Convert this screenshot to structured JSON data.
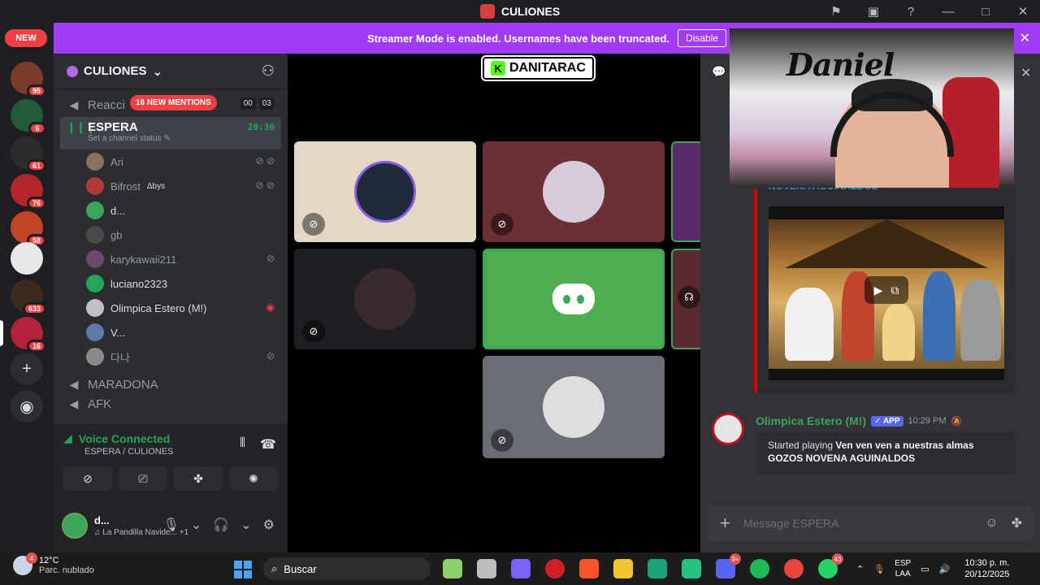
{
  "window": {
    "title": "CULIONES",
    "icons": [
      "flag-icon",
      "inbox-icon",
      "help-icon",
      "minimize-icon",
      "maximize-icon",
      "close-icon"
    ]
  },
  "rail": {
    "new_label": "NEW",
    "servers": [
      {
        "badge": "95",
        "color": "#7a3b2c"
      },
      {
        "badge": "6",
        "color": "#1f5a3a"
      },
      {
        "badge": "61",
        "color": "#2b2b2b"
      },
      {
        "badge": "76",
        "color": "#b5262c"
      },
      {
        "badge": "58",
        "color": "#c2452a"
      },
      {
        "badge": "",
        "color": "#e8e8e8"
      },
      {
        "badge": "633",
        "color": "#3b2a1e"
      },
      {
        "badge": "16",
        "color": "#b3223a"
      }
    ]
  },
  "banner": {
    "text": "Streamer Mode is enabled. Usernames have been truncated.",
    "button": "Disable"
  },
  "guild": {
    "name": "CULIONES"
  },
  "channels": {
    "reacc": {
      "name": "Reacci",
      "mentions": "16 NEW MENTIONS",
      "count_a": "00",
      "count_b": "03"
    },
    "active": {
      "name": "ESPERA",
      "timer": "20:36",
      "status": "Set a channel status"
    },
    "users": [
      {
        "name": "Ari",
        "color": "#8a7060"
      },
      {
        "name": "Bifrost",
        "tag": "Δbys",
        "color": "#b03a3a"
      },
      {
        "name": "d...",
        "color": "#3ba55c",
        "bright": true
      },
      {
        "name": "gb",
        "color": "#4a4a4a"
      },
      {
        "name": "karykawaii211",
        "color": "#6a4a6a"
      },
      {
        "name": "luciano2323",
        "color": "#23a55a",
        "bright": true
      },
      {
        "name": "Olimpica Estero (M!)",
        "color": "#c0c0c0",
        "bright": true
      },
      {
        "name": "V...",
        "color": "#5a7aa8",
        "bright": true
      },
      {
        "name": "다나",
        "color": "#8a8a8a"
      }
    ],
    "maradona": "MARADONA",
    "afk": "AFK"
  },
  "voice": {
    "title": "Voice Connected",
    "subtitle": "ESPERA / CULIONES"
  },
  "user": {
    "name": "d...",
    "activity": "La Pandilla Navide...",
    "extra": "+1"
  },
  "stage": {
    "streamer_label": "DANITARAC"
  },
  "chat": {
    "embed_title": "NOVENA AGUINALDOS",
    "message": {
      "author": "Olimpica Estero (M!)",
      "tag": "APP",
      "time": "10:29 PM",
      "prefix": "Started playing",
      "song": "Ven ven ven a nuestras almas GOZOS NOVENA AGUINALDOS"
    },
    "composer_placeholder": "Message ESPERA"
  },
  "taskbar": {
    "temp": "12°C",
    "condition": "Parc. nublado",
    "weather_badge": "4",
    "search": "Buscar",
    "apps": [
      {
        "name": "widgets-app",
        "color": "#8bd16a",
        "badge": ""
      },
      {
        "name": "task-view-app",
        "color": "#bdbdbd",
        "badge": ""
      },
      {
        "name": "copilot-app",
        "color": "#7b61ff",
        "badge": ""
      },
      {
        "name": "opera-app",
        "color": "#d11f2a",
        "badge": ""
      },
      {
        "name": "brave-app",
        "color": "#fb542b",
        "badge": ""
      },
      {
        "name": "explorer-app",
        "color": "#f4c431",
        "badge": ""
      },
      {
        "name": "terminal-app",
        "color": "#1aa37a",
        "badge": ""
      },
      {
        "name": "obs-app",
        "color": "#26c281",
        "badge": ""
      },
      {
        "name": "discord-app",
        "color": "#5865f2",
        "badge": "9+"
      },
      {
        "name": "spotify-app",
        "color": "#1db954",
        "badge": ""
      },
      {
        "name": "chrome-app",
        "color": "#e8453c",
        "badge": ""
      },
      {
        "name": "whatsapp-app",
        "color": "#25d366",
        "badge": "43"
      }
    ],
    "lang_1": "ESP",
    "lang_2": "LAA",
    "time": "10:30 p. m.",
    "date": "20/12/2025"
  }
}
